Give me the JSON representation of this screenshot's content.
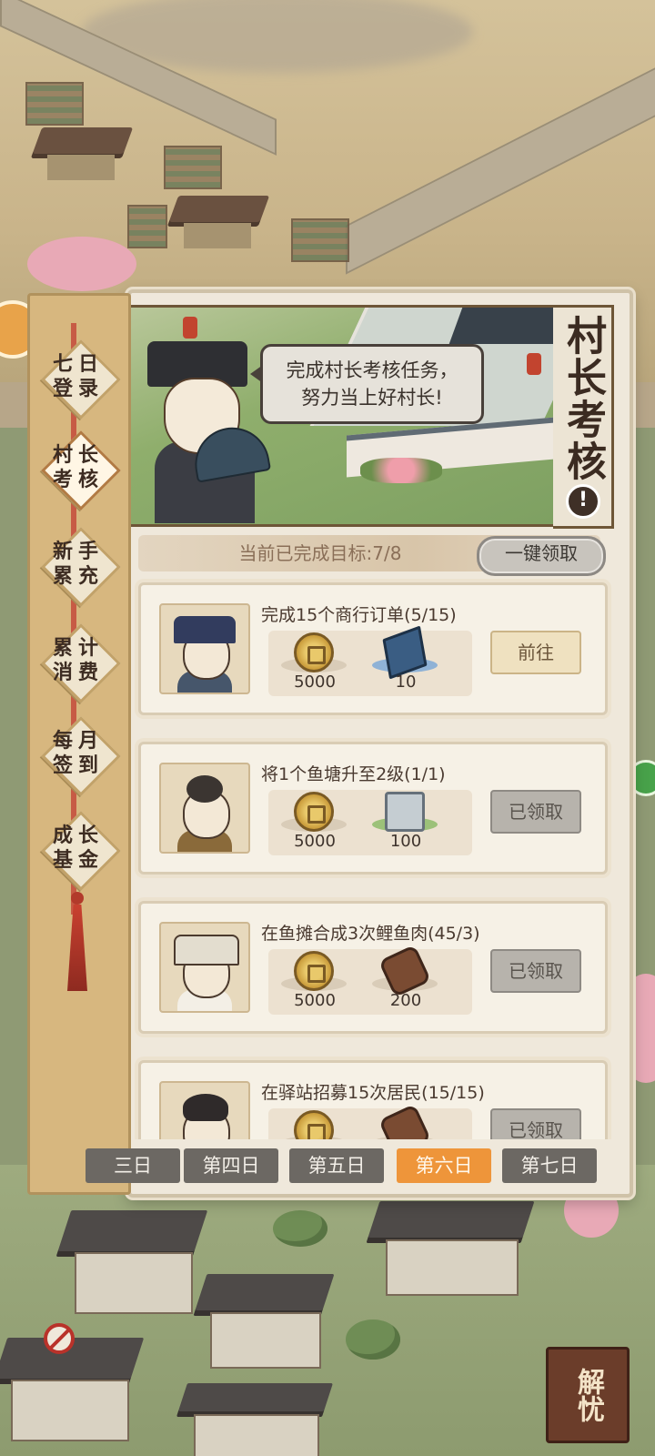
{
  "panel": {
    "title": "村长考核",
    "speech_line1": "完成村长考核任务，",
    "speech_line2": "努力当上好村长!",
    "progress_text": "当前已完成目标:7/8",
    "claim_all_label": "一键领取"
  },
  "sidebar": {
    "tabs": [
      {
        "label": "七日登录",
        "active": false
      },
      {
        "label": "村长考核",
        "active": true
      },
      {
        "label": "新手累充",
        "active": false
      },
      {
        "label": "累计消费",
        "active": false
      },
      {
        "label": "每月签到",
        "active": false
      },
      {
        "label": "成长基金",
        "active": false
      }
    ]
  },
  "tasks": [
    {
      "title": "完成15个商行订单(5/15)",
      "rewards": [
        {
          "icon": "copper-coin-icon",
          "amount": "5000"
        },
        {
          "icon": "book-icon",
          "amount": "10"
        }
      ],
      "button": "前往",
      "state": "go"
    },
    {
      "title": "将1个鱼塘升至2级(1/1)",
      "rewards": [
        {
          "icon": "copper-coin-icon",
          "amount": "5000"
        },
        {
          "icon": "stone-block-icon",
          "amount": "100"
        }
      ],
      "button": "已领取",
      "state": "done"
    },
    {
      "title": "在鱼摊合成3次鲤鱼肉(45/3)",
      "rewards": [
        {
          "icon": "copper-coin-icon",
          "amount": "5000"
        },
        {
          "icon": "wood-log-icon",
          "amount": "200"
        }
      ],
      "button": "已领取",
      "state": "done"
    },
    {
      "title": "在驿站招募15次居民(15/15)",
      "rewards": [
        {
          "icon": "copper-coin-icon",
          "amount": ""
        },
        {
          "icon": "wood-log-icon",
          "amount": ""
        }
      ],
      "button": "已领取",
      "state": "done"
    }
  ],
  "day_tabs": [
    {
      "label": "三日",
      "active": false
    },
    {
      "label": "第四日",
      "active": false
    },
    {
      "label": "第五日",
      "active": false
    },
    {
      "label": "第六日",
      "active": true
    },
    {
      "label": "第七日",
      "active": false
    }
  ],
  "corner_button": "解忧",
  "colors": {
    "active_day_tab": "#ee953a",
    "inactive_day_tab": "#6c6863",
    "panel_bg": "#efe8db"
  }
}
